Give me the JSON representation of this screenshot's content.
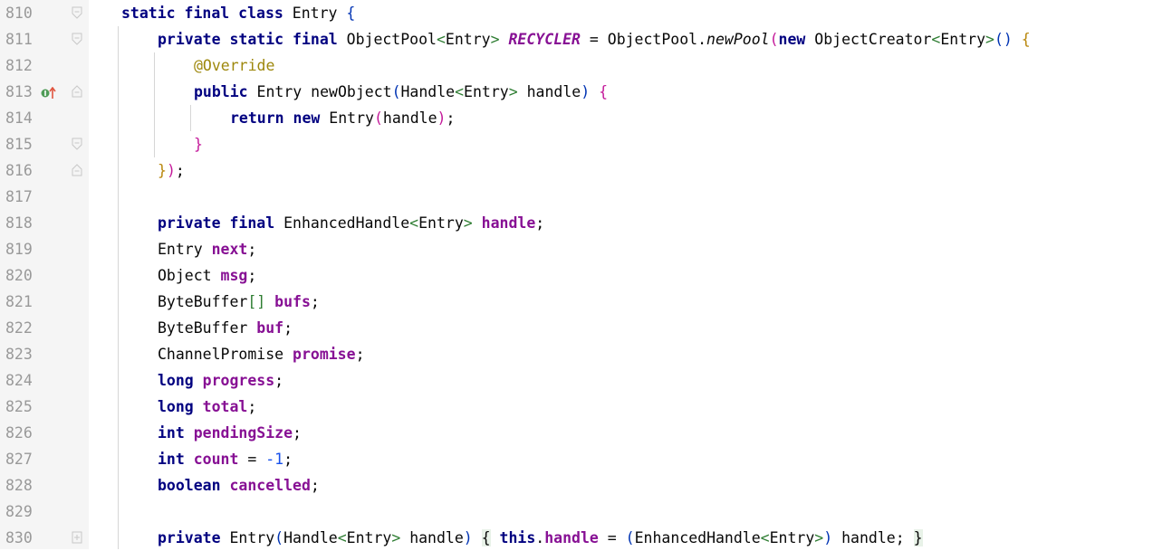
{
  "editor": {
    "lines": [
      {
        "n": "810",
        "indent": 0,
        "fold": "open",
        "tokens": [
          {
            "t": "static ",
            "c": "kw2"
          },
          {
            "t": "final ",
            "c": "kw2"
          },
          {
            "t": "class ",
            "c": "kw2"
          },
          {
            "t": "Entry ",
            "c": ""
          },
          {
            "t": "{",
            "c": "pb"
          }
        ]
      },
      {
        "n": "811",
        "indent": 1,
        "fold": "open",
        "tokens": [
          {
            "t": "private ",
            "c": "kw2"
          },
          {
            "t": "static ",
            "c": "kw2"
          },
          {
            "t": "final ",
            "c": "kw2"
          },
          {
            "t": "ObjectPool",
            "c": ""
          },
          {
            "t": "<",
            "c": "pty"
          },
          {
            "t": "Entry",
            "c": ""
          },
          {
            "t": "> ",
            "c": "pty"
          },
          {
            "t": "RECYCLER",
            "c": "sfld"
          },
          {
            "t": " = ObjectPool.",
            "c": ""
          },
          {
            "t": "newPool",
            "c": "ital"
          },
          {
            "t": "(",
            "c": "pm"
          },
          {
            "t": "new ",
            "c": "kw2"
          },
          {
            "t": "ObjectCreator",
            "c": ""
          },
          {
            "t": "<",
            "c": "pty"
          },
          {
            "t": "Entry",
            "c": ""
          },
          {
            "t": ">",
            "c": "pty"
          },
          {
            "t": "() ",
            "c": "pb"
          },
          {
            "t": "{",
            "c": "py"
          }
        ]
      },
      {
        "n": "812",
        "indent": 2,
        "fold": "",
        "tokens": [
          {
            "t": "@Override",
            "c": "ann"
          }
        ]
      },
      {
        "n": "813",
        "indent": 2,
        "fold": "close",
        "marker": true,
        "tokens": [
          {
            "t": "public ",
            "c": "kw2"
          },
          {
            "t": "Entry ",
            "c": ""
          },
          {
            "t": "newObject",
            "c": ""
          },
          {
            "t": "(",
            "c": "pb"
          },
          {
            "t": "Handle",
            "c": ""
          },
          {
            "t": "<",
            "c": "pty"
          },
          {
            "t": "Entry",
            "c": ""
          },
          {
            "t": "> ",
            "c": "pty"
          },
          {
            "t": "handle",
            "c": ""
          },
          {
            "t": ") ",
            "c": "pb"
          },
          {
            "t": "{",
            "c": "pm"
          }
        ]
      },
      {
        "n": "814",
        "indent": 3,
        "fold": "",
        "tokens": [
          {
            "t": "return ",
            "c": "kw2"
          },
          {
            "t": "new ",
            "c": "kw2"
          },
          {
            "t": "Entry",
            "c": ""
          },
          {
            "t": "(",
            "c": "pm"
          },
          {
            "t": "handle",
            "c": ""
          },
          {
            "t": ")",
            "c": "pm"
          },
          {
            "t": ";",
            "c": ""
          }
        ]
      },
      {
        "n": "815",
        "indent": 2,
        "fold": "open",
        "tokens": [
          {
            "t": "}",
            "c": "pm"
          }
        ]
      },
      {
        "n": "816",
        "indent": 1,
        "fold": "close",
        "tokens": [
          {
            "t": "}",
            "c": "py"
          },
          {
            "t": ")",
            "c": "pm"
          },
          {
            "t": ";",
            "c": ""
          }
        ]
      },
      {
        "n": "817",
        "indent": 0,
        "fold": "",
        "tokens": []
      },
      {
        "n": "818",
        "indent": 1,
        "fold": "",
        "tokens": [
          {
            "t": "private ",
            "c": "kw2"
          },
          {
            "t": "final ",
            "c": "kw2"
          },
          {
            "t": "EnhancedHandle",
            "c": ""
          },
          {
            "t": "<",
            "c": "pty"
          },
          {
            "t": "Entry",
            "c": ""
          },
          {
            "t": "> ",
            "c": "pty"
          },
          {
            "t": "handle",
            "c": "fld"
          },
          {
            "t": ";",
            "c": ""
          }
        ]
      },
      {
        "n": "819",
        "indent": 1,
        "fold": "",
        "tokens": [
          {
            "t": "Entry ",
            "c": ""
          },
          {
            "t": "next",
            "c": "fld"
          },
          {
            "t": ";",
            "c": ""
          }
        ]
      },
      {
        "n": "820",
        "indent": 1,
        "fold": "",
        "tokens": [
          {
            "t": "Object ",
            "c": ""
          },
          {
            "t": "msg",
            "c": "fld"
          },
          {
            "t": ";",
            "c": ""
          }
        ]
      },
      {
        "n": "821",
        "indent": 1,
        "fold": "",
        "tokens": [
          {
            "t": "ByteBuffer",
            "c": ""
          },
          {
            "t": "[] ",
            "c": "pty"
          },
          {
            "t": "bufs",
            "c": "fld"
          },
          {
            "t": ";",
            "c": ""
          }
        ]
      },
      {
        "n": "822",
        "indent": 1,
        "fold": "",
        "tokens": [
          {
            "t": "ByteBuffer ",
            "c": ""
          },
          {
            "t": "buf",
            "c": "fld"
          },
          {
            "t": ";",
            "c": ""
          }
        ]
      },
      {
        "n": "823",
        "indent": 1,
        "fold": "",
        "tokens": [
          {
            "t": "ChannelPromise ",
            "c": ""
          },
          {
            "t": "promise",
            "c": "fld"
          },
          {
            "t": ";",
            "c": ""
          }
        ]
      },
      {
        "n": "824",
        "indent": 1,
        "fold": "",
        "tokens": [
          {
            "t": "long ",
            "c": "kw2"
          },
          {
            "t": "progress",
            "c": "fld"
          },
          {
            "t": ";",
            "c": ""
          }
        ]
      },
      {
        "n": "825",
        "indent": 1,
        "fold": "",
        "tokens": [
          {
            "t": "long ",
            "c": "kw2"
          },
          {
            "t": "total",
            "c": "fld"
          },
          {
            "t": ";",
            "c": ""
          }
        ]
      },
      {
        "n": "826",
        "indent": 1,
        "fold": "",
        "tokens": [
          {
            "t": "int ",
            "c": "kw2"
          },
          {
            "t": "pendingSize",
            "c": "fld"
          },
          {
            "t": ";",
            "c": ""
          }
        ]
      },
      {
        "n": "827",
        "indent": 1,
        "fold": "",
        "tokens": [
          {
            "t": "int ",
            "c": "kw2"
          },
          {
            "t": "count",
            "c": "fld"
          },
          {
            "t": " = ",
            "c": ""
          },
          {
            "t": "-1",
            "c": "num"
          },
          {
            "t": ";",
            "c": ""
          }
        ]
      },
      {
        "n": "828",
        "indent": 1,
        "fold": "",
        "tokens": [
          {
            "t": "boolean ",
            "c": "kw2"
          },
          {
            "t": "cancelled",
            "c": "fld"
          },
          {
            "t": ";",
            "c": ""
          }
        ]
      },
      {
        "n": "829",
        "indent": 0,
        "fold": "",
        "tokens": []
      },
      {
        "n": "830",
        "indent": 1,
        "fold": "plus",
        "tokens": [
          {
            "t": "private ",
            "c": "kw2"
          },
          {
            "t": "Entry",
            "c": ""
          },
          {
            "t": "(",
            "c": "pb"
          },
          {
            "t": "Handle",
            "c": ""
          },
          {
            "t": "<",
            "c": "pty"
          },
          {
            "t": "Entry",
            "c": ""
          },
          {
            "t": "> ",
            "c": "pty"
          },
          {
            "t": "handle",
            "c": ""
          },
          {
            "t": ") ",
            "c": "pb"
          },
          {
            "t": "{",
            "c": "hl"
          },
          {
            "t": " ",
            "c": ""
          },
          {
            "t": "this",
            "c": "kw2"
          },
          {
            "t": ".",
            "c": ""
          },
          {
            "t": "handle",
            "c": "fld"
          },
          {
            "t": " = ",
            "c": ""
          },
          {
            "t": "(",
            "c": "pb"
          },
          {
            "t": "EnhancedHandle",
            "c": ""
          },
          {
            "t": "<",
            "c": "pty"
          },
          {
            "t": "Entry",
            "c": ""
          },
          {
            "t": ">",
            "c": "pty"
          },
          {
            "t": ") ",
            "c": "pb"
          },
          {
            "t": "handle; ",
            "c": ""
          },
          {
            "t": "}",
            "c": "hl"
          }
        ]
      }
    ],
    "colors": {
      "background": "#ffffff",
      "gutter": "#f5f5f5",
      "line_number": "#999999",
      "keyword": "#000080",
      "field": "#871094",
      "annotation": "#9e880d"
    }
  }
}
